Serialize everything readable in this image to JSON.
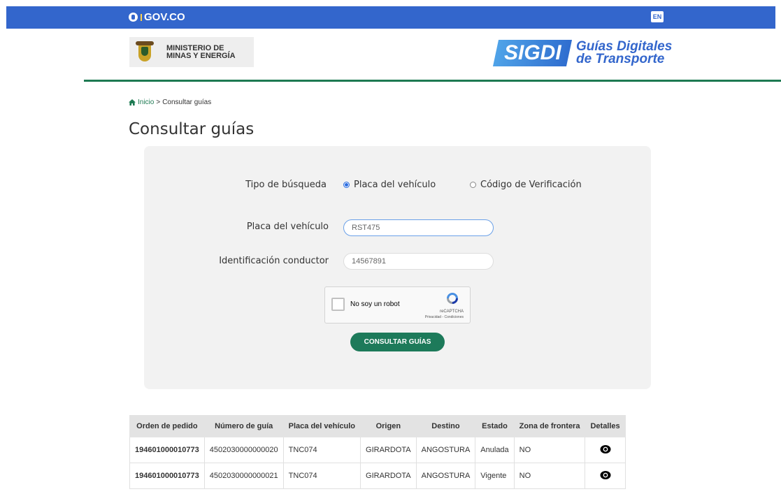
{
  "govbar": {
    "logo_text": "GOV.CO",
    "lang_button": "EN"
  },
  "header": {
    "ministerio_line1": "MINISTERIO DE",
    "ministerio_line2": "MINAS Y ENERGÍA",
    "sigdi_text": "SIGDI",
    "sigdi_title_line1": "Guías Digitales",
    "sigdi_title_line2": "de Transporte"
  },
  "breadcrumb": {
    "home": "Inicio",
    "separator": ">",
    "current": "Consultar guías"
  },
  "page_title": "Consultar guías",
  "form": {
    "tipo_label": "Tipo de búsqueda",
    "options": [
      {
        "label": "Placa del vehículo",
        "selected": true
      },
      {
        "label": "Código de Verificación",
        "selected": false
      }
    ],
    "placa_label": "Placa del vehículo",
    "placa_value": "RST475",
    "id_label": "Identificación conductor",
    "id_value": "14567891",
    "captcha": {
      "label": "No soy un robot",
      "brand": "reCAPTCHA",
      "sub": "Privacidad - Condiciones"
    },
    "submit_label": "CONSULTAR GUÍAS"
  },
  "table": {
    "headers": [
      "Orden de pedido",
      "Número de guía",
      "Placa del vehículo",
      "Origen",
      "Destino",
      "Estado",
      "Zona de frontera",
      "Detalles"
    ],
    "rows": [
      [
        "194601000010773",
        "4502030000000020",
        "TNC074",
        "GIRARDOTA",
        "ANGOSTURA",
        "Anulada",
        "NO"
      ],
      [
        "194601000010773",
        "4502030000000021",
        "TNC074",
        "GIRARDOTA",
        "ANGOSTURA",
        "Vigente",
        "NO"
      ]
    ],
    "details_icon": "eye-icon"
  },
  "colors": {
    "gov_blue": "#3366cc",
    "accent_green": "#1d7a5a",
    "panel_bg": "#f2f2f2"
  }
}
